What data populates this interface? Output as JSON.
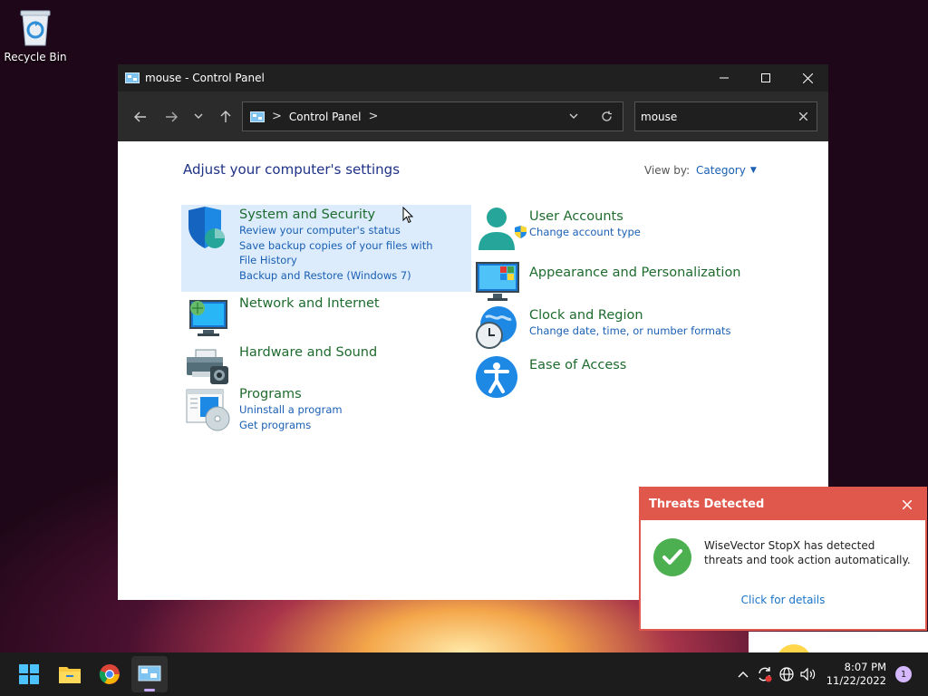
{
  "desktop": {
    "recycle_bin_label": "Recycle Bin"
  },
  "window": {
    "title": "mouse - Control Panel",
    "address": {
      "separator": ">",
      "segment": "Control Panel"
    },
    "search": {
      "value": "mouse"
    }
  },
  "control_panel": {
    "heading": "Adjust your computer's settings",
    "view_by_label": "View by:",
    "view_by_value": "Category",
    "categories": [
      {
        "title": "System and Security",
        "links": [
          "Review your computer's status",
          "Save backup copies of your files with File History",
          "Backup and Restore (Windows 7)"
        ]
      },
      {
        "title": "Network and Internet",
        "links": []
      },
      {
        "title": "Hardware and Sound",
        "links": []
      },
      {
        "title": "Programs",
        "links": [
          "Uninstall a program",
          "Get programs"
        ]
      },
      {
        "title": "User Accounts",
        "links": [
          "Change account type"
        ]
      },
      {
        "title": "Appearance and Personalization",
        "links": []
      },
      {
        "title": "Clock and Region",
        "links": [
          "Change date, time, or number formats"
        ]
      },
      {
        "title": "Ease of Access",
        "links": []
      }
    ]
  },
  "toast": {
    "title": "Threats Detected",
    "message": "WiseVector StopX has detected threats and took action automatically.",
    "details_link": "Click for details",
    "header_color": "#e0584c",
    "icon": "checkmark-icon"
  },
  "taskbar": {
    "apps": [
      "start-icon",
      "file-explorer-icon",
      "chrome-icon",
      "control-panel-icon"
    ],
    "time": "8:07 PM",
    "date": "11/22/2022",
    "notification_count": "1"
  }
}
